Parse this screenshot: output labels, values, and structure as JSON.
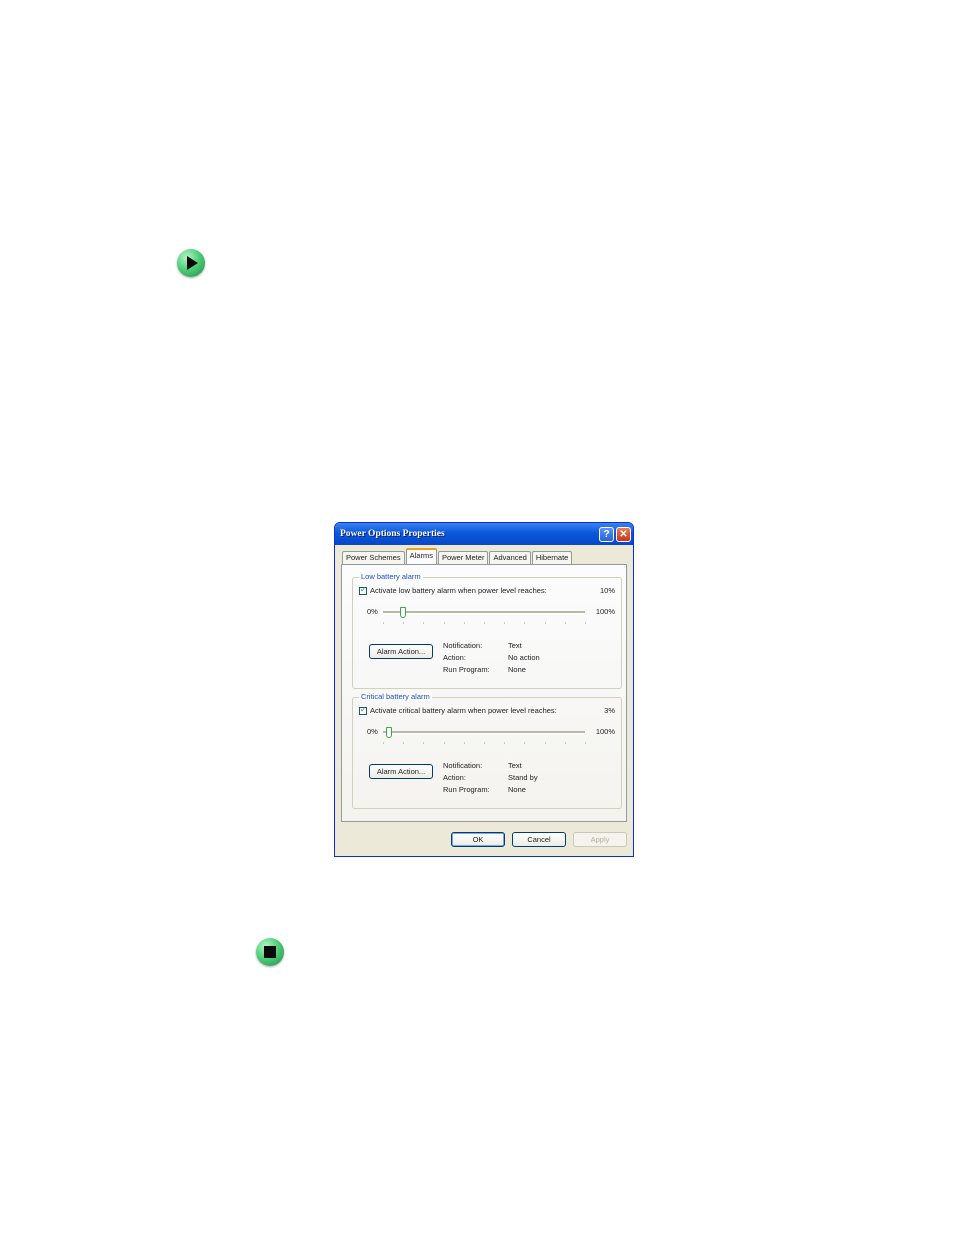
{
  "dialog": {
    "title": "Power Options Properties",
    "help_glyph": "?",
    "close_glyph": "✕",
    "tabs": [
      "Power Schemes",
      "Alarms",
      "Power Meter",
      "Advanced",
      "Hibernate"
    ],
    "active_tab": "Alarms",
    "low_alarm": {
      "legend": "Low battery alarm",
      "checkbox_label": "Activate low battery alarm when power level reaches:",
      "checked": true,
      "percent_text": "10%",
      "level_percent": 10,
      "slider_min": "0%",
      "slider_max": "100%",
      "action_button": "Alarm Action...",
      "info": [
        {
          "key": "Notification:",
          "value": "Text"
        },
        {
          "key": "Action:",
          "value": "No action"
        },
        {
          "key": "Run Program:",
          "value": "None"
        }
      ]
    },
    "critical_alarm": {
      "legend": "Critical battery alarm",
      "checkbox_label": "Activate critical battery alarm when power level reaches:",
      "checked": true,
      "percent_text": "3%",
      "level_percent": 3,
      "slider_min": "0%",
      "slider_max": "100%",
      "action_button": "Alarm Action...",
      "info": [
        {
          "key": "Notification:",
          "value": "Text"
        },
        {
          "key": "Action:",
          "value": "Stand by"
        },
        {
          "key": "Run Program:",
          "value": "None"
        }
      ]
    },
    "buttons": {
      "ok": "OK",
      "cancel": "Cancel",
      "apply": "Apply"
    }
  },
  "icons": {
    "top": "play-arrow-icon",
    "bottom": "stop-square-icon"
  }
}
